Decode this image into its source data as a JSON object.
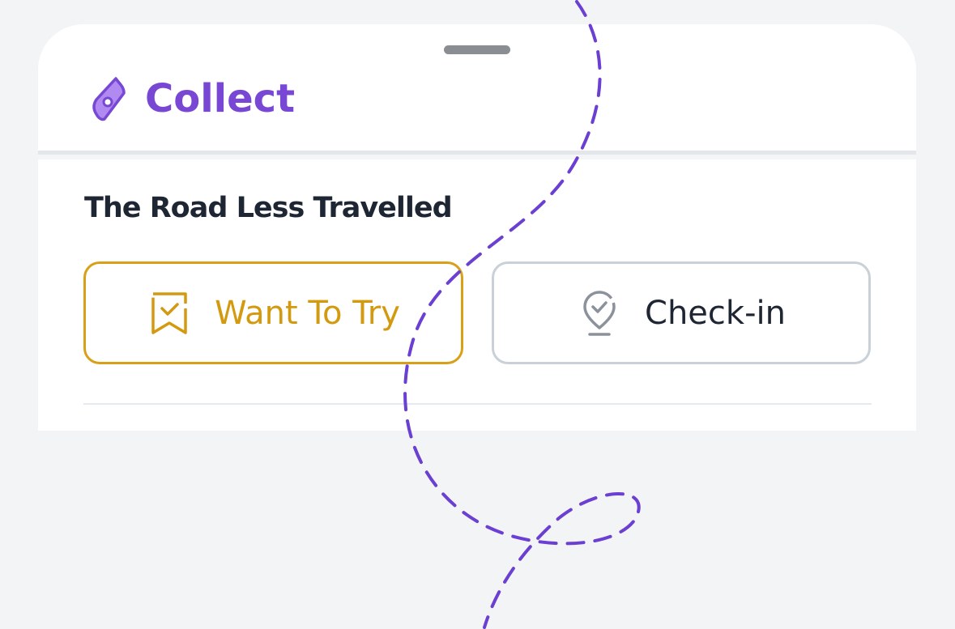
{
  "header": {
    "title": "Collect",
    "icon": "map-pin-diamond-icon",
    "accent_color": "#7848d4"
  },
  "place": {
    "name": "The Road Less Travelled"
  },
  "actions": {
    "want_to_try": {
      "label": "Want To Try",
      "icon": "bookmark-check-icon",
      "color": "#d39a10"
    },
    "check_in": {
      "label": "Check-in",
      "icon": "location-check-icon",
      "color": "#1f2633"
    }
  },
  "colors": {
    "background": "#f3f4f6",
    "sheet": "#ffffff",
    "decor_path": "#6a3fd1"
  }
}
